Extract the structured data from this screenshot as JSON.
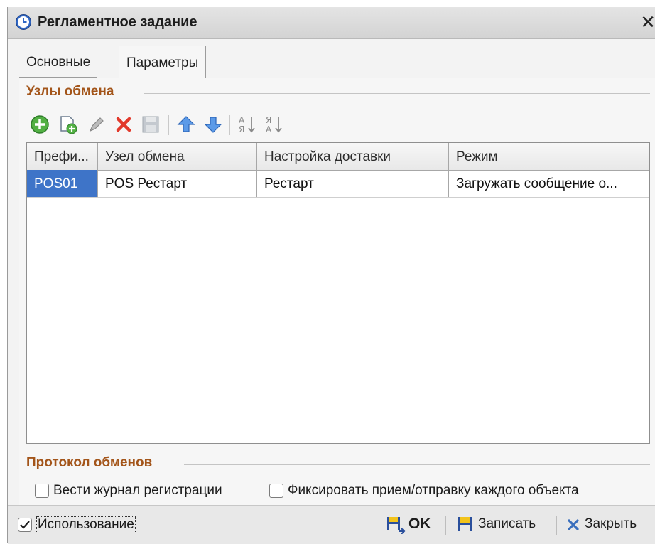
{
  "window": {
    "title": "Регламентное задание",
    "close_glyph": "✕"
  },
  "tabs": [
    {
      "label": "Основные",
      "active": false
    },
    {
      "label": "Параметры",
      "active": true
    }
  ],
  "exchange_nodes": {
    "group_title": "Узлы обмена",
    "toolbar": [
      {
        "name": "add-icon"
      },
      {
        "name": "copy-icon"
      },
      {
        "name": "edit-icon"
      },
      {
        "name": "delete-icon"
      },
      {
        "name": "save-icon"
      },
      {
        "name": "move-up-icon"
      },
      {
        "name": "move-down-icon"
      },
      {
        "name": "sort-ascending-icon"
      },
      {
        "name": "sort-descending-icon"
      }
    ],
    "columns": [
      "Префи...",
      "Узел обмена",
      "Настройка доставки",
      "Режим"
    ],
    "rows": [
      {
        "prefix": "POS01",
        "node": "POS Рестарт",
        "delivery": "Рестарт",
        "mode": "Загружать сообщение о..."
      }
    ]
  },
  "protocol": {
    "group_title": "Протокол обменов",
    "log_checkbox": {
      "label": "Вести журнал регистрации",
      "checked": false
    },
    "fix_checkbox": {
      "label": "Фиксировать прием/отправку каждого объекта",
      "checked": false
    }
  },
  "footer": {
    "use_checkbox": {
      "label": "Использование",
      "checked": true
    },
    "ok_label": "OK",
    "save_label": "Записать",
    "close_label": "Закрыть"
  },
  "colors": {
    "group_title": "#a3551a",
    "selection": "#3e74c8"
  }
}
